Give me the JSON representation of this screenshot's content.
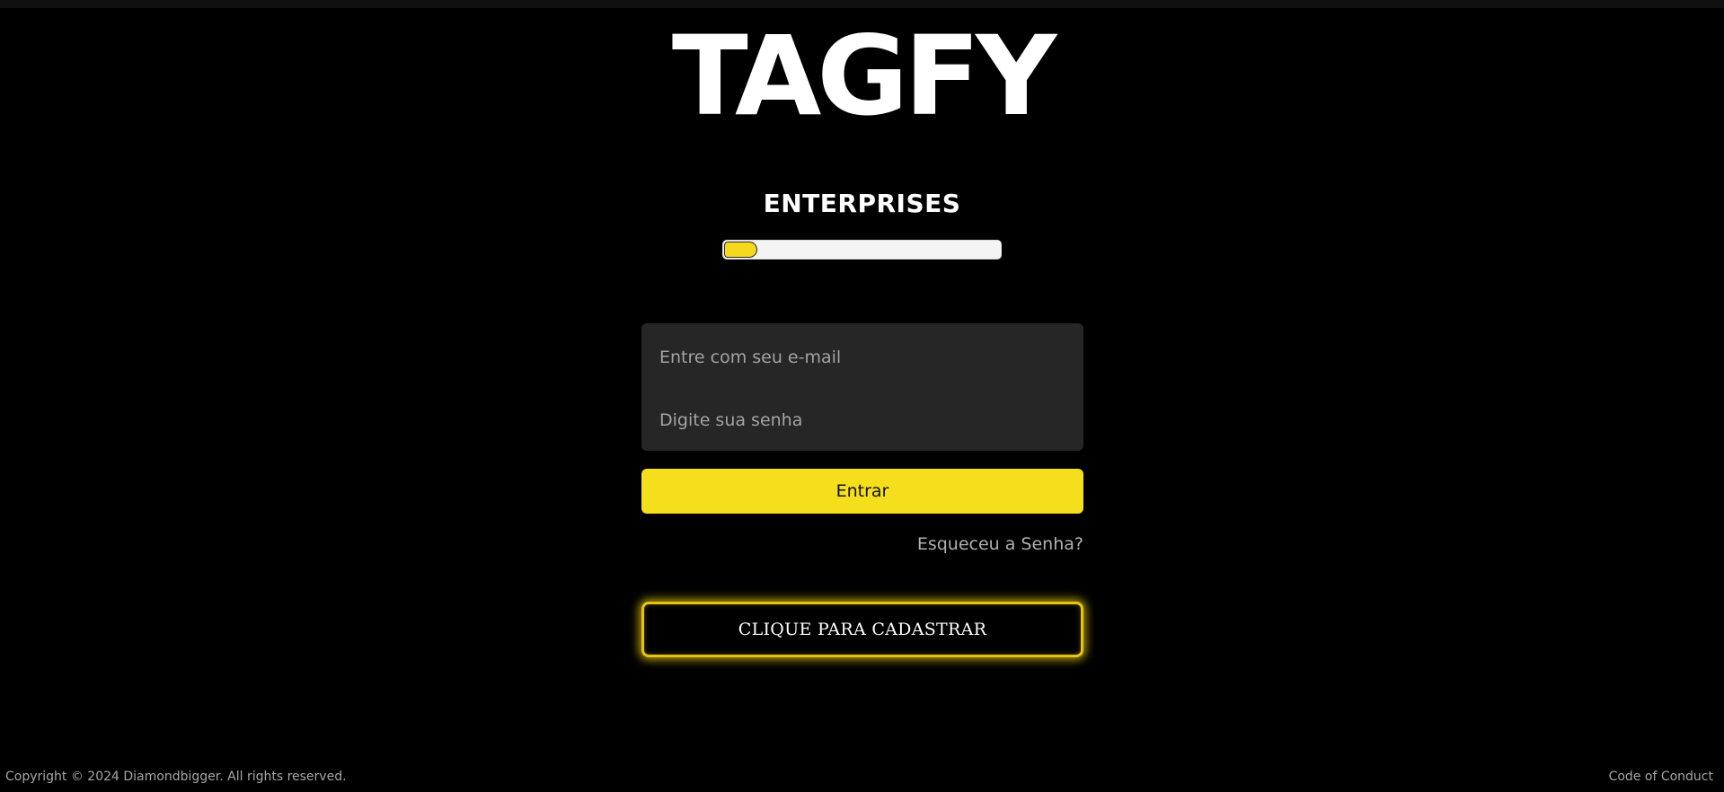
{
  "brand": {
    "logo_text": "TAGFY",
    "subtitle": "ENTERPRISES"
  },
  "toggle": {
    "fill_fraction": 0.12,
    "fill_color": "#f5d91c",
    "track_color": "#f4f4f4"
  },
  "login_form": {
    "email_placeholder": "Entre com seu e-mail",
    "password_placeholder": "Digite sua senha",
    "submit_label": "Entrar",
    "forgot_password_label": "Esqueceu a Senha?"
  },
  "register": {
    "label": "CLIQUE PARA CADASTRAR"
  },
  "footer": {
    "copyright": "Copyright © 2024 Diamondbigger. All rights reserved.",
    "code_of_conduct": "Code of Conduct"
  },
  "colors": {
    "background": "#000000",
    "accent": "#f5df1d",
    "form_background": "#262626"
  }
}
